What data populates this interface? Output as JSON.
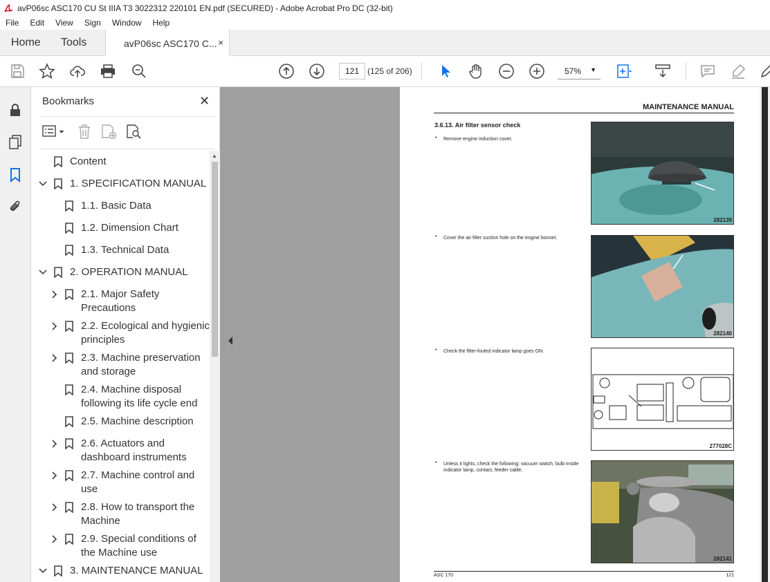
{
  "window": {
    "title": "avP06sc ASC170 CU St IIIA T3 3022312 220101 EN.pdf (SECURED) - Adobe Acrobat Pro DC (32-bit)"
  },
  "menu": [
    "File",
    "Edit",
    "View",
    "Sign",
    "Window",
    "Help"
  ],
  "tabs": {
    "home": "Home",
    "tools": "Tools",
    "doc": "avP06sc ASC170 C...",
    "close": "×"
  },
  "toolbar": {
    "page_current": "121",
    "page_of": "(125 of 206)",
    "zoom": "57%"
  },
  "bookmarks": {
    "title": "Bookmarks",
    "items": [
      {
        "label": "Content"
      },
      {
        "label": "1. SPECIFICATION MANUAL"
      },
      {
        "label": "1.1. Basic Data"
      },
      {
        "label": "1.2. Dimension Chart"
      },
      {
        "label": "1.3. Technical Data"
      },
      {
        "label": "2. OPERATION MANUAL"
      },
      {
        "label": "2.1. Major Safety",
        "label2": "Precautions"
      },
      {
        "label": "2.2. Ecological and hygienic",
        "label2": "principles"
      },
      {
        "label": "2.3. Machine preservation",
        "label2": "and storage"
      },
      {
        "label": "2.4. Machine disposal",
        "label2": "following its life cycle end"
      },
      {
        "label": "2.5. Machine description"
      },
      {
        "label": "2.6. Actuators and",
        "label2": "dashboard instruments"
      },
      {
        "label": "2.7. Machine control and",
        "label2": "use"
      },
      {
        "label": "2.8. How to transport the",
        "label2": "Machine"
      },
      {
        "label": "2.9. Special conditions of",
        "label2": "the Machine use"
      },
      {
        "label": "3. MAINTENANCE MANUAL"
      }
    ]
  },
  "document": {
    "header": "MAINTENANCE MANUAL",
    "section": "3.6.13. Air filter sensor check",
    "steps": [
      "Remove engine induction cover.",
      "Cover the air filter suction hole on the engine bonnet.",
      "Check the filter-fouled indicator lamp goes ON.",
      "Unless it lights, check the following: vacuum switch, bulb inside indicator lamp, contact, feeder cable."
    ],
    "bullet": "•",
    "captions": [
      "282139",
      "282140",
      "277028C",
      "282141"
    ],
    "footer_left": "ASC 170",
    "footer_right": "121"
  }
}
